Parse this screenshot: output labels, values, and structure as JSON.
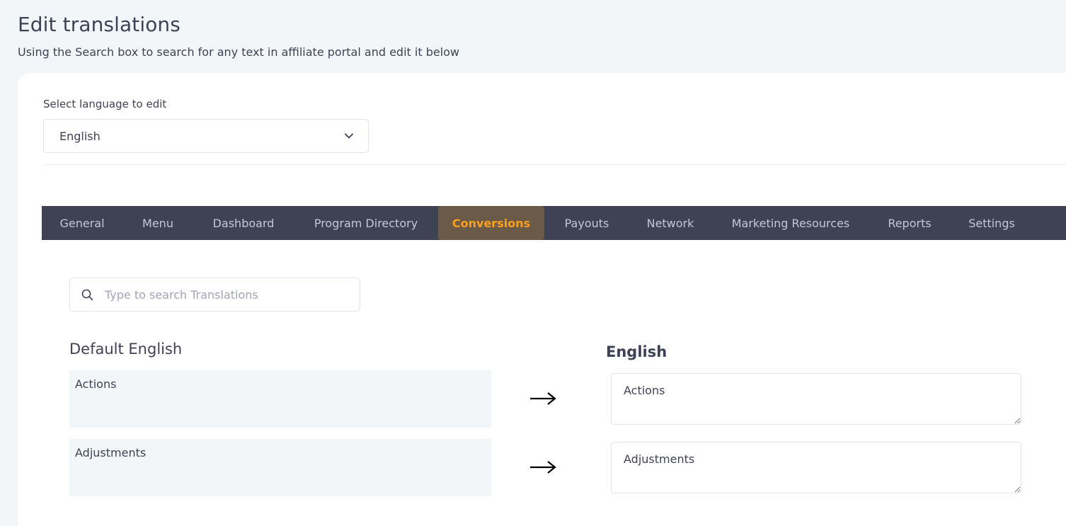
{
  "page": {
    "title": "Edit translations",
    "subtitle": "Using the Search box to search for any text in affiliate portal and edit it below"
  },
  "language": {
    "label": "Select language to edit",
    "selected": "English"
  },
  "tabs": [
    {
      "label": "General",
      "active": false
    },
    {
      "label": "Menu",
      "active": false
    },
    {
      "label": "Dashboard",
      "active": false
    },
    {
      "label": "Program Directory",
      "active": false
    },
    {
      "label": "Conversions",
      "active": true
    },
    {
      "label": "Payouts",
      "active": false
    },
    {
      "label": "Network",
      "active": false
    },
    {
      "label": "Marketing Resources",
      "active": false
    },
    {
      "label": "Reports",
      "active": false
    },
    {
      "label": "Settings",
      "active": false
    }
  ],
  "search": {
    "placeholder": "Type to search Translations",
    "value": ""
  },
  "columns": {
    "default_title": "Default English",
    "target_title": "English"
  },
  "rows": [
    {
      "default": "Actions",
      "translation": "Actions"
    },
    {
      "default": "Adjustments",
      "translation": "Adjustments"
    }
  ],
  "colors": {
    "tabbar_bg": "#3f4254",
    "tab_active_bg": "#6b5a48",
    "tab_active_text": "#ff9f1c",
    "page_bg": "#f3f6f9"
  }
}
